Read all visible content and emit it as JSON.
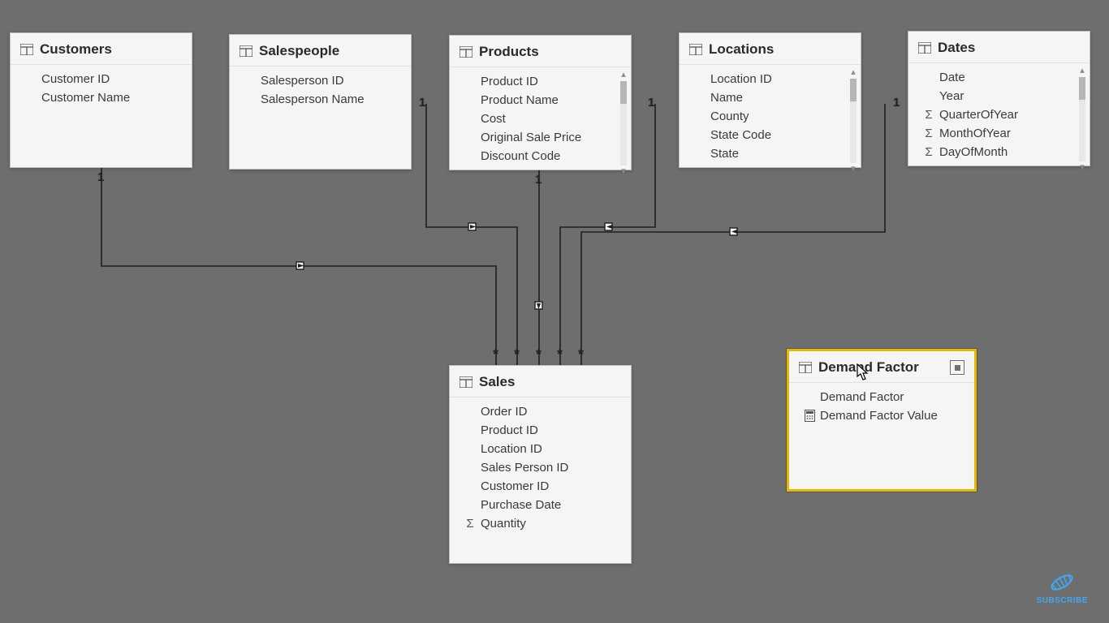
{
  "tables": {
    "customers": {
      "title": "Customers",
      "fields": [
        {
          "label": "Customer ID",
          "glyph": ""
        },
        {
          "label": "Customer Name",
          "glyph": ""
        }
      ]
    },
    "salespeople": {
      "title": "Salespeople",
      "fields": [
        {
          "label": "Salesperson ID",
          "glyph": ""
        },
        {
          "label": "Salesperson Name",
          "glyph": ""
        }
      ]
    },
    "products": {
      "title": "Products",
      "fields": [
        {
          "label": "Product ID",
          "glyph": ""
        },
        {
          "label": "Product Name",
          "glyph": ""
        },
        {
          "label": "Cost",
          "glyph": ""
        },
        {
          "label": "Original Sale Price",
          "glyph": ""
        },
        {
          "label": "Discount Code",
          "glyph": ""
        }
      ]
    },
    "locations": {
      "title": "Locations",
      "fields": [
        {
          "label": "Location ID",
          "glyph": ""
        },
        {
          "label": "Name",
          "glyph": ""
        },
        {
          "label": "County",
          "glyph": ""
        },
        {
          "label": "State Code",
          "glyph": ""
        },
        {
          "label": "State",
          "glyph": ""
        }
      ]
    },
    "dates": {
      "title": "Dates",
      "fields": [
        {
          "label": "Date",
          "glyph": ""
        },
        {
          "label": "Year",
          "glyph": ""
        },
        {
          "label": "QuarterOfYear",
          "glyph": "Σ"
        },
        {
          "label": "MonthOfYear",
          "glyph": "Σ"
        },
        {
          "label": "DayOfMonth",
          "glyph": "Σ"
        }
      ]
    },
    "sales": {
      "title": "Sales",
      "fields": [
        {
          "label": "Order ID",
          "glyph": ""
        },
        {
          "label": "Product ID",
          "glyph": ""
        },
        {
          "label": "Location ID",
          "glyph": ""
        },
        {
          "label": "Sales Person ID",
          "glyph": ""
        },
        {
          "label": "Customer ID",
          "glyph": ""
        },
        {
          "label": "Purchase Date",
          "glyph": ""
        },
        {
          "label": "Quantity",
          "glyph": "Σ"
        }
      ]
    },
    "demand": {
      "title": "Demand Factor",
      "fields": [
        {
          "label": "Demand Factor",
          "glyph": ""
        },
        {
          "label": "Demand Factor Value",
          "glyph": "calc"
        }
      ]
    }
  },
  "cardinality": {
    "one": "1",
    "many": "*"
  },
  "subscribe": {
    "label": "SUBSCRIBE"
  }
}
